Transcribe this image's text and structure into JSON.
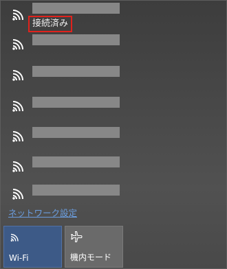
{
  "networks": [
    {
      "status": "接続済み"
    },
    {},
    {},
    {},
    {},
    {},
    {}
  ],
  "links": {
    "network_settings": "ネットワーク設定"
  },
  "quick_actions": {
    "wifi_label": "Wi-Fi",
    "airplane_label": "機内モード"
  },
  "colors": {
    "wifi_tile_active": "#3d5a87",
    "airplane_tile": "#6a6a6a",
    "link": "#6b9ee0",
    "highlight_box": "#e1221c"
  }
}
